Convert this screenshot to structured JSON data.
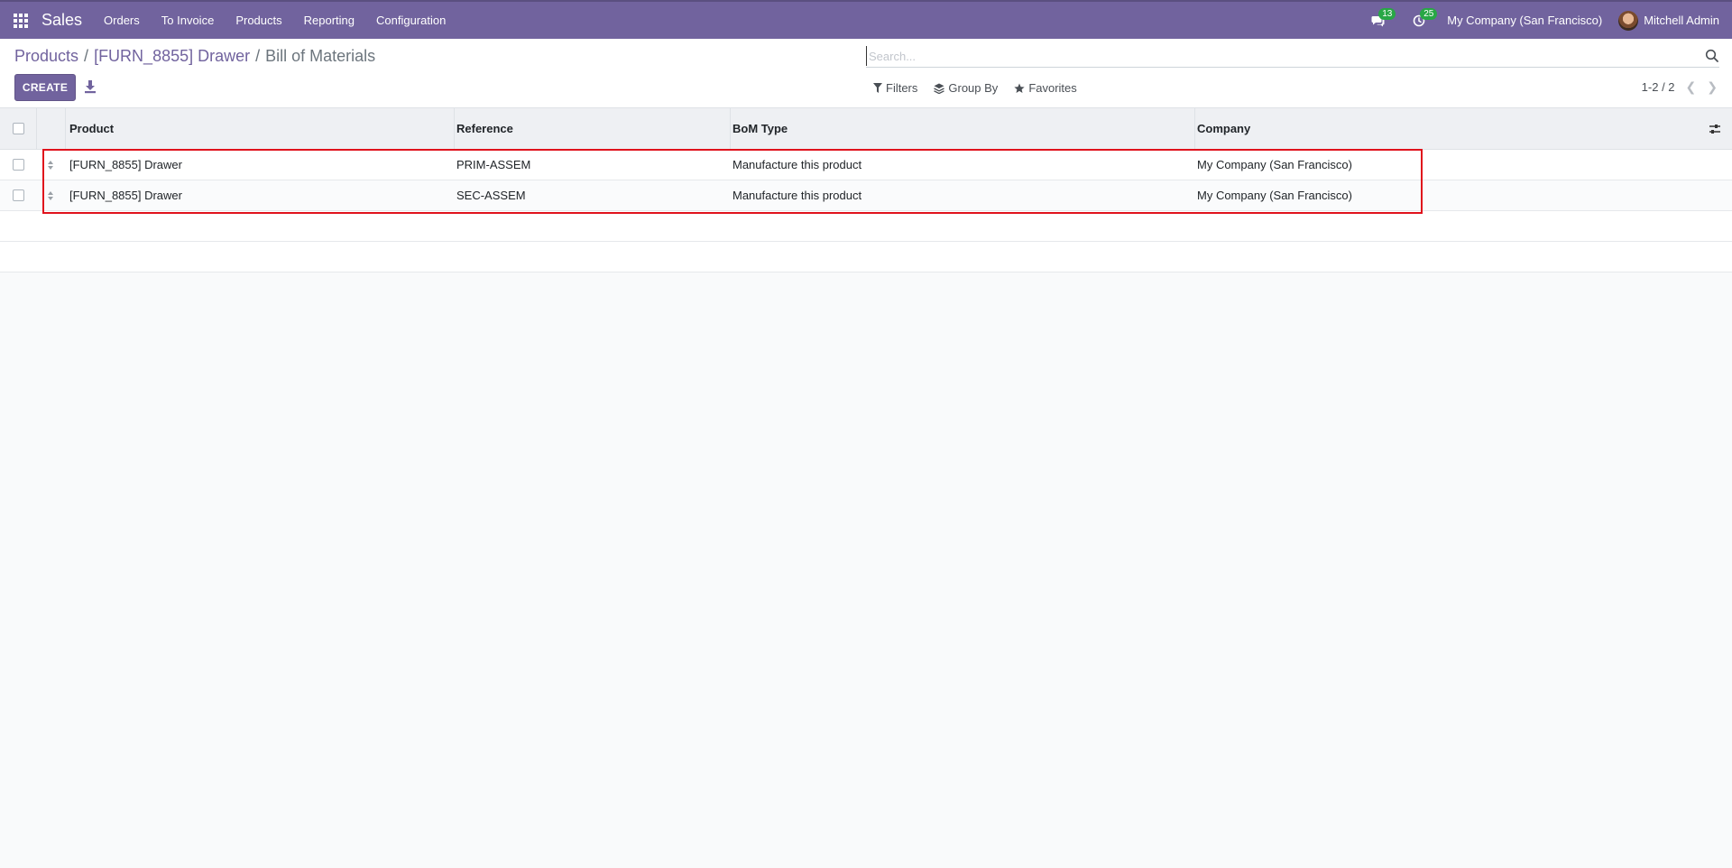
{
  "navbar": {
    "app_name": "Sales",
    "menu": [
      "Orders",
      "To Invoice",
      "Products",
      "Reporting",
      "Configuration"
    ],
    "messages_count": "13",
    "activities_count": "25",
    "company": "My Company (San Francisco)",
    "user": "Mitchell Admin",
    "icons": {
      "apps": "apps-grid-icon",
      "messages": "chat-icon",
      "activities": "clock-icon"
    }
  },
  "breadcrumb": {
    "items": [
      "Products",
      "[FURN_8855] Drawer"
    ],
    "current": "Bill of Materials",
    "separator": "/"
  },
  "toolbar": {
    "create_label": "CREATE",
    "download_icon": "download-icon"
  },
  "search": {
    "placeholder": "Search...",
    "value": ""
  },
  "filters": {
    "filters_label": "Filters",
    "group_by_label": "Group By",
    "favorites_label": "Favorites"
  },
  "pager": {
    "value": "1-2 / 2"
  },
  "table": {
    "headers": {
      "product": "Product",
      "reference": "Reference",
      "bom_type": "BoM Type",
      "company": "Company"
    },
    "rows": [
      {
        "product": "[FURN_8855] Drawer",
        "reference": "PRIM-ASSEM",
        "bom_type": "Manufacture this product",
        "company": "My Company (San Francisco)"
      },
      {
        "product": "[FURN_8855] Drawer",
        "reference": "SEC-ASSEM",
        "bom_type": "Manufacture this product",
        "company": "My Company (San Francisco)"
      }
    ]
  },
  "colors": {
    "brand": "#71639e",
    "highlight": "#e0121c",
    "badge": "#28a745"
  }
}
